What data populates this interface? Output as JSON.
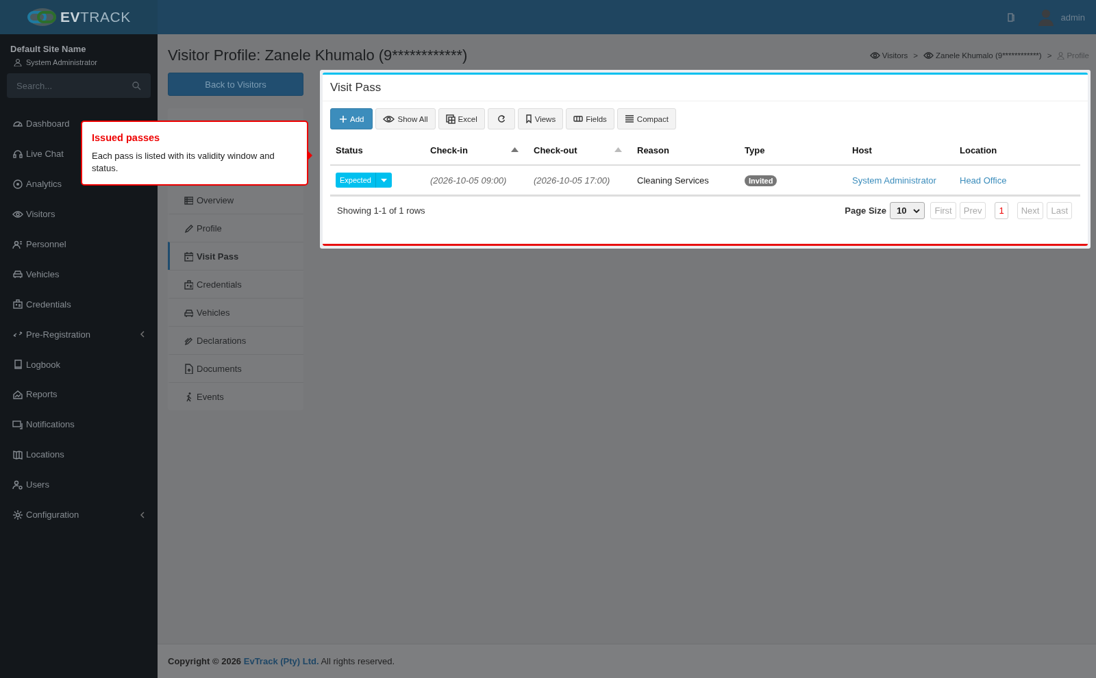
{
  "header": {
    "logo": "**EV**TRACK",
    "user": "admin"
  },
  "sidebar": {
    "site_name": "Default Site Name",
    "user_role": "System Administrator",
    "search": {
      "placeholder": "Search..."
    },
    "items": [
      {
        "label": "Dashboard"
      },
      {
        "label": "Live Chat"
      },
      {
        "label": "Analytics"
      },
      {
        "label": "Visitors",
        "has_submenu": false
      },
      {
        "label": "Personnel",
        "has_submenu": false
      },
      {
        "label": "Vehicles",
        "has_submenu": false
      },
      {
        "label": "Credentials",
        "has_submenu": false
      },
      {
        "label": "Pre-Registration",
        "has_submenu": true
      },
      {
        "label": "Logbook",
        "has_submenu": false
      },
      {
        "label": "Reports",
        "has_submenu": false
      },
      {
        "label": "Notifications",
        "has_submenu": false
      },
      {
        "label": "Locations",
        "has_submenu": false
      },
      {
        "label": "Users",
        "has_submenu": false
      },
      {
        "label": "Configuration",
        "has_submenu": true
      }
    ]
  },
  "page": {
    "title": "Visitor Profile: Zanele Khumalo (9************)",
    "breadcrumb_separator": ">",
    "breadcrumb": [
      {
        "label": "Visitors"
      },
      {
        "label": "Zanele Khumalo (9************)"
      },
      {
        "label": "Profile"
      }
    ],
    "back_button": "Back to Visitors"
  },
  "subnav": {
    "items": [
      {
        "label": "Overview",
        "selected": false
      },
      {
        "label": "Profile",
        "selected": false
      },
      {
        "label": "Visit Pass",
        "selected": true
      },
      {
        "label": "Credentials",
        "selected": false
      },
      {
        "label": "Vehicles",
        "selected": false
      },
      {
        "label": "Declarations",
        "selected": false
      },
      {
        "label": "Documents",
        "selected": false
      },
      {
        "label": "Events",
        "selected": false
      }
    ]
  },
  "tour": {
    "title": "Issued passes",
    "text": "Each pass is listed with its validity window and status."
  },
  "card": {
    "title": "Visit Pass",
    "toolbar": [
      {
        "kind": "primary",
        "label": "Add"
      },
      {
        "kind": "default",
        "label": "Show All"
      },
      {
        "kind": "default",
        "label": "Excel"
      },
      {
        "kind": "icon"
      },
      {
        "kind": "default",
        "label": "Views"
      },
      {
        "kind": "default",
        "label": "Fields"
      },
      {
        "kind": "default",
        "label": "Compact"
      }
    ],
    "table": {
      "columns": [
        {
          "label": "Status",
          "sortable": false
        },
        {
          "label": "Check-in",
          "sortable": true,
          "sorted": true
        },
        {
          "label": "Check-out",
          "sortable": true,
          "sorted": false
        },
        {
          "label": "Reason",
          "sortable": false
        },
        {
          "label": "Type",
          "sortable": false
        },
        {
          "label": "Host",
          "sortable": false
        },
        {
          "label": "Location",
          "sortable": false
        }
      ],
      "rows": [
        {
          "status": "Expected",
          "check_in": "(2026-10-05 09:00)",
          "check_out": "(2026-10-05 17:00)",
          "reason": "Cleaning Services",
          "type": "Invited",
          "host": "System Administrator",
          "location": "Head Office"
        }
      ]
    },
    "showing": "Showing 1-1 of 1 rows",
    "page_size_label": "Page Size",
    "page_size": "10",
    "pagination": [
      {
        "label": "First",
        "disabled": true,
        "selected": false
      },
      {
        "label": "Prev",
        "disabled": true,
        "selected": false
      },
      {
        "label": "1",
        "disabled": false,
        "selected": true
      },
      {
        "label": "Next",
        "disabled": true,
        "selected": false
      },
      {
        "label": "Last",
        "disabled": true,
        "selected": false
      }
    ]
  },
  "footer": {
    "prefix": "Copyright © 2026",
    "link": "EvTrack (Pty) Ltd.",
    "suffix": "All rights reserved."
  }
}
